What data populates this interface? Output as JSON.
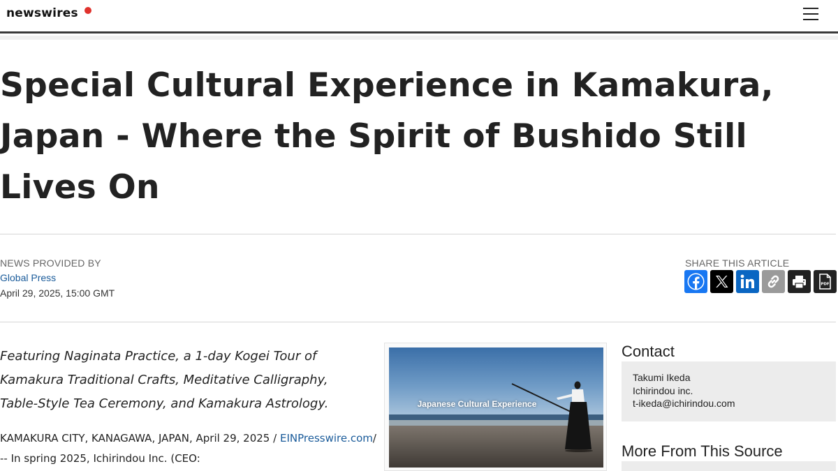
{
  "header": {
    "logo_text": "newswires",
    "menu_icon": "hamburger-icon"
  },
  "article": {
    "headline": "Special Cultural Experience in Kamakura, Japan - Where the Spirit of Bushido Still Lives On",
    "provided_by_label": "NEWS PROVIDED BY",
    "provider": "Global Press",
    "datetime": "April 29, 2025, 15:00 GMT",
    "lede": "Featuring Naginata Practice, a 1-day Kogei Tour of Kamakura Traditional Crafts, Meditative Calligraphy, Table-Style Tea Ceremony, and Kamakura Astrology.",
    "dateline": "KAMAKURA CITY, KANAGAWA, JAPAN, April 29, 2025 /",
    "source_link": "EINPresswire.com",
    "body_intro": "/ -- In spring 2025, Ichirindou Inc. (CEO:",
    "image_caption": "Japanese Cultural Experience"
  },
  "share": {
    "label": "SHARE THIS ARTICLE",
    "buttons": [
      {
        "name": "facebook",
        "icon": "facebook-icon",
        "color": "#1877f2"
      },
      {
        "name": "x",
        "icon": "x-icon",
        "color": "#000000"
      },
      {
        "name": "linkedin",
        "icon": "linkedin-icon",
        "color": "#0a66c2"
      },
      {
        "name": "copy-link",
        "icon": "link-icon",
        "color": "#9a9a9a"
      },
      {
        "name": "print",
        "icon": "printer-icon",
        "color": "#222222"
      },
      {
        "name": "pdf",
        "icon": "pdf-icon",
        "color": "#222222"
      }
    ]
  },
  "sidebar": {
    "contact_title": "Contact",
    "contact_name": "Takumi Ikeda",
    "contact_company": "Ichirindou inc.",
    "contact_email": "t-ikeda@ichirindou.com",
    "more_title": "More From This Source"
  },
  "colors": {
    "link": "#1a5b9a",
    "logo_dot": "#e0322d",
    "panel_bg": "#ececec"
  }
}
